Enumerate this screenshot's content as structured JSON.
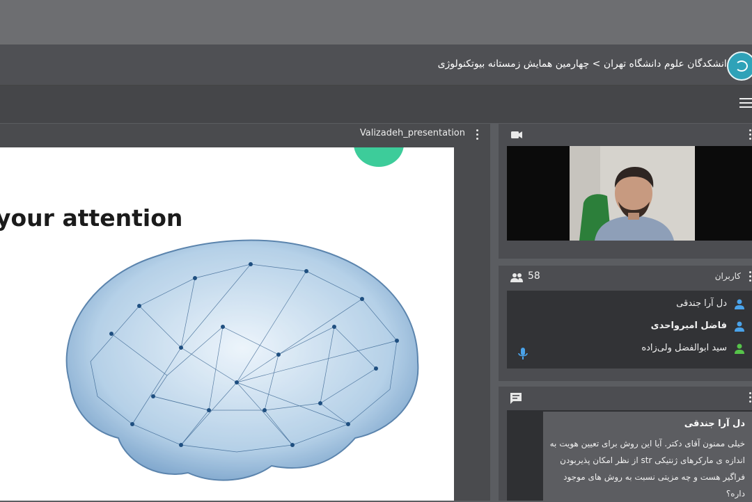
{
  "header": {
    "breadcrumb": "دانشکدگان علوم دانشگاه تهران > چهارمین همایش زمستانه بیوتکنولوژی",
    "logo_icon": "university-logo-icon",
    "menu_icon": "hamburger-menu-icon"
  },
  "presentation": {
    "filename": "Valizadeh_presentation",
    "slide_heading": "your attention",
    "slide_image": "network-brain-illustration",
    "accent_color": "#3dcc9a"
  },
  "video": {
    "icon": "camera-icon"
  },
  "users": {
    "count": "58",
    "label": "کاربران",
    "list": [
      {
        "name": "دل آرا جندقی",
        "bold": false,
        "color": "#4aa3ea"
      },
      {
        "name": "فاضل امیرواحدی",
        "bold": true,
        "color": "#4aa3ea"
      },
      {
        "name": "سید ابوالفضل ولی‌زاده",
        "bold": false,
        "color": "#56c44a"
      }
    ],
    "mic_icon": "microphone-icon"
  },
  "chat": {
    "icon": "chat-icon",
    "sender": "دل آرا جندقی",
    "message": "خیلی ممنون آقای دکتر. آیا این روش برای تعیین هویت به اندازه ی مارکرهای ژنتیکی str از نظر امکان پذیربودن فراگیر هست و چه مزیتی نسبت به روش های موجود داره؟"
  }
}
